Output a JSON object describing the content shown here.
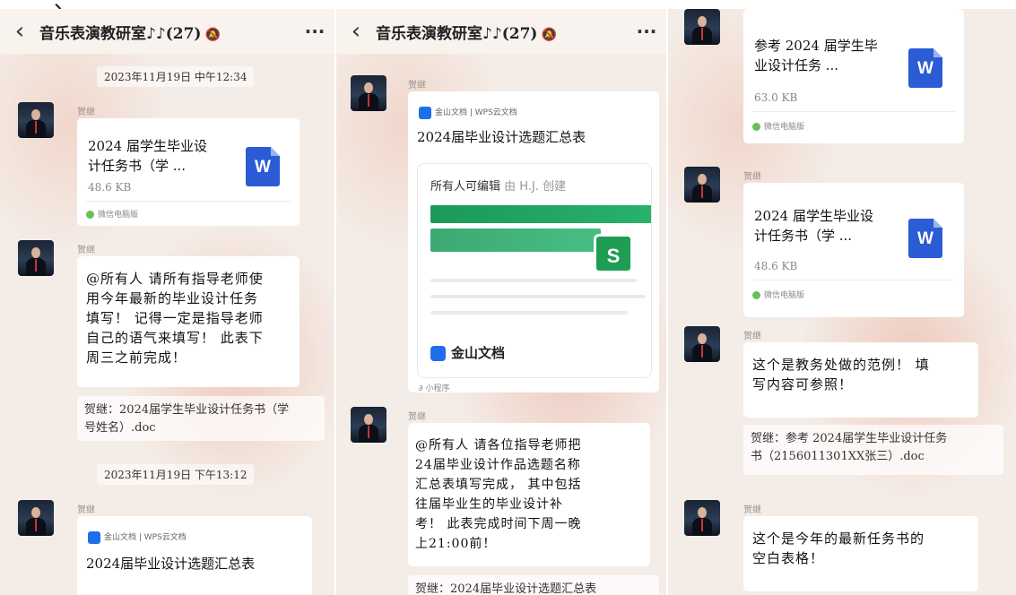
{
  "colors": {
    "word_blue": "#2b5cd6",
    "sheet_green": "#1f9d55",
    "kingsoft_blue": "#1f6feb",
    "wechat_green": "#6bbf59"
  },
  "chat": {
    "title": "音乐表演教研室",
    "count": "(27)",
    "back_icon": "‹",
    "more_icon": "···"
  },
  "sender": "贺继",
  "doc1": {
    "title_l1": "2024 届学生毕业设",
    "title_l2": "计任务书（学 ...",
    "size": "48.6 KB",
    "source": "微信电脑版",
    "icon": "W"
  },
  "doc2": {
    "title_l1": "参考 2024 届学生毕",
    "title_l2": "业设计任务 ...",
    "size": "63.0 KB",
    "source": "微信电脑版",
    "icon": "W"
  },
  "p1": {
    "time1": "2023年11月19日 中午12:34",
    "msg": [
      "@所有人 请所有指导老师使",
      "用今年最新的毕业设计任务",
      "填写！ 记得一定是指导老师",
      "自己的语气来填写！ 此表下",
      "周三之前完成！"
    ],
    "quote": [
      "贺继：2024届学生毕业设计任务书（学",
      "号姓名）.doc"
    ],
    "time2": "2023年11月19日 下午13:12",
    "kcard": {
      "brand": "金山文档 | WPS云文档",
      "title": "2024届毕业设计选题汇总表"
    }
  },
  "p2": {
    "kcard": {
      "brand": "金山文档 | WPS云文档",
      "title": "2024届毕业设计选题汇总表",
      "perm": "所有人可编辑",
      "perm_by": "由 H.J. 创建",
      "sheet_icon": "S",
      "footer_brand": "金山文档",
      "mini": "小程序"
    },
    "msg": [
      "@所有人 请各位指导老师把",
      "24届毕业设计作品选题名称",
      "汇总表填写完成， 其中包括",
      "往届毕业生的毕业设计补",
      "考！ 此表完成时间下周一晚",
      "上21:00前！"
    ],
    "quote": "贺继：2024届毕业设计选题汇总表"
  },
  "p3": {
    "msg1": [
      "这个是教务处做的范例！ 填",
      "写内容可参照！"
    ],
    "quote": [
      "贺继：参考 2024届学生毕业设计任务",
      "书（2156011301XX张三）.doc"
    ],
    "msg2": [
      "这个是今年的最新任务书的",
      "空白表格！"
    ]
  }
}
